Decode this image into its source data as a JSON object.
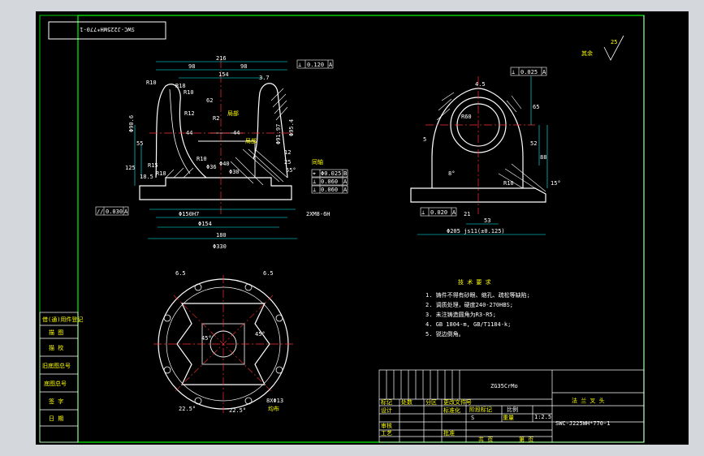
{
  "colors": {
    "background": "#000000",
    "frame": "#00ff00",
    "geometry": "#ffffff",
    "dimension": "#00ffff",
    "text": "#ffff00",
    "center": "#ff3030"
  },
  "drawing_code_rotated": "SWC-J225WH*770-1",
  "surface_finish": {
    "label": "其余",
    "value": "25"
  },
  "tolerance_frames": [
    {
      "symbol": "⊥",
      "value": "0.120",
      "datum": "A"
    },
    {
      "symbol": "⊥",
      "value": "0.025",
      "datum": "A"
    },
    {
      "symbol": "⌖",
      "value": "Φ0.025",
      "datum": "B"
    },
    {
      "symbol": "⊥",
      "value": "0.060",
      "datum": "A"
    },
    {
      "symbol": "⊥",
      "value": "0.060",
      "datum": "A"
    },
    {
      "symbol": "//",
      "value": "0.030",
      "datum": "A"
    },
    {
      "symbol": "⊥",
      "value": "0.020",
      "datum": "A"
    }
  ],
  "front_view": {
    "dims": [
      "216",
      "98",
      "98",
      "154",
      "3.7",
      "R10",
      "R18",
      "R10",
      "R12",
      "62",
      "44",
      "44",
      "Φ90.6",
      "55",
      "125",
      "18.5",
      "R15",
      "R18",
      "Φ36",
      "R10",
      "Φ40",
      "Φ30",
      "Φ95.4",
      "Φ91.97",
      "12",
      "25",
      "55°",
      "Φ150H7",
      "Φ154",
      "180",
      "Φ330",
      "2XM8-6H",
      "R2"
    ],
    "labels": [
      "局部",
      "局部",
      "同轴"
    ]
  },
  "side_view": {
    "dims": [
      "R60",
      "4.5",
      "65",
      "52",
      "88",
      "5",
      "15°",
      "8°",
      "R10",
      "53",
      "21",
      "Φ205 js11(±0.125)"
    ]
  },
  "bottom_view": {
    "dims": [
      "6.5",
      "6.5",
      "45°",
      "45°",
      "22.5°",
      "22.5°",
      "8XΦ13",
      "均布"
    ]
  },
  "tech_requirements": {
    "title": "技 术 要 求",
    "items": [
      "1. 铸件不得有砂眼、缩孔、疏松等缺陷;",
      "2. 调质处理，硬度240-270HBS;",
      "3. 未注铸造圆角为R3-R5;",
      "4. GB 1804-m, GB/T1184-k;",
      "5. 锐边倒角。"
    ]
  },
  "title_block": {
    "material": "ZG35CrMo",
    "part_name": "法 兰 叉 头",
    "drawing_no": "SWC-J225WH*770-1",
    "scale_label": "比例",
    "scale": "1:2.5",
    "stage": "S",
    "sheet_total": "共 页",
    "sheet_no": "第 页",
    "rows": [
      "标记",
      "处数",
      "分区",
      "更改文件号",
      "签名",
      "年月日",
      "设计",
      "标准化",
      "审核",
      "工艺",
      "批准",
      "阶段标记",
      "重量"
    ]
  },
  "left_block": [
    "借(通)用件登记",
    "描 图",
    "描 校",
    "旧底图总号",
    "底图总号",
    "签 字",
    "日 期"
  ]
}
